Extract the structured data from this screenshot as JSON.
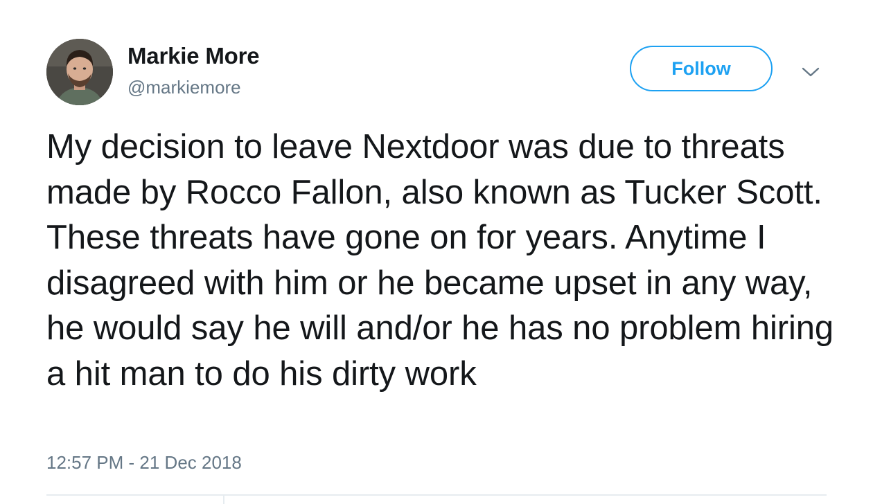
{
  "tweet": {
    "author": {
      "display_name": "Markie More",
      "handle": "@markiemore",
      "avatar_icon": "user-avatar-photo"
    },
    "follow_label": "Follow",
    "more_icon": "chevron-down-icon",
    "text": "My decision to leave Nextdoor was due to threats made by Rocco Fallon, also known as Tucker Scott. These threats have gone on for years. Anytime I disagreed with him or he became upset in any way, he would say he will and/or he has no problem hiring a hit man to do his dirty work",
    "timestamp": "12:57 PM - 21 Dec 2018"
  },
  "colors": {
    "accent": "#1da1f2",
    "text": "#14171a",
    "secondary_text": "#657786",
    "divider": "#e6ecf0"
  }
}
